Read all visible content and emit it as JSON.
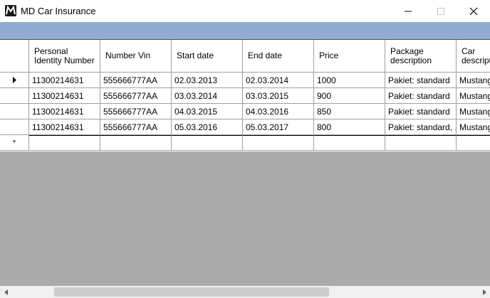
{
  "window": {
    "title": "MD Car Insurance",
    "icon": "md-logo-icon"
  },
  "grid": {
    "columns": [
      "Personal Identity Number",
      "Number Vin",
      "Start date",
      "End date",
      "Price",
      "Package description",
      "Car description"
    ],
    "rows": [
      [
        "11300214631",
        "555666777AA",
        "02.03.2013",
        "02.03.2014",
        "1000",
        "Pakiet: standard",
        "Mustang"
      ],
      [
        "11300214631",
        "555666777AA",
        "03.03.2014",
        "03.03.2015",
        "900",
        "Pakiet: standard",
        "Mustang"
      ],
      [
        "11300214631",
        "555666777AA",
        "04.03.2015",
        "04.03.2016",
        "850",
        "Pakiet: standard",
        "Mustang"
      ],
      [
        "11300214631",
        "555666777AA",
        "05.03.2016",
        "05.03.2017",
        "800",
        "Pakiet: standard, ...",
        "Mustang"
      ]
    ],
    "current_row_marker": "▸",
    "new_row_marker": "*"
  },
  "colors": {
    "toolbar_band": "#92acd1",
    "empty_area": "#ababab",
    "grid_line": "#a0a0a0"
  }
}
